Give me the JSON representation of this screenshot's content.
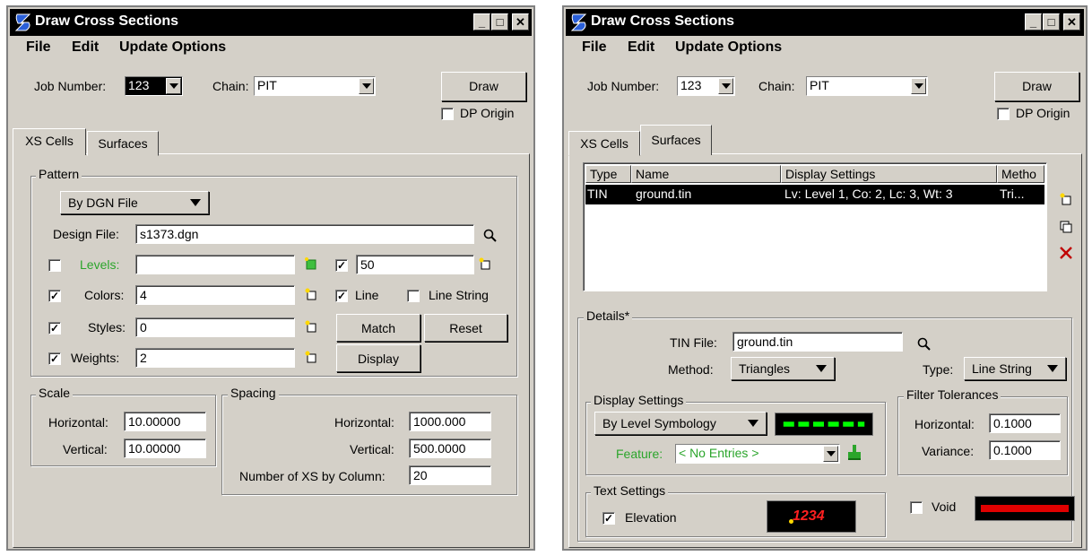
{
  "left_window": {
    "title": "Draw Cross Sections",
    "menu": [
      "File",
      "Edit",
      "Update Options"
    ],
    "job_number_label": "Job Number:",
    "job_number_value": "123",
    "chain_label": "Chain:",
    "chain_value": "PIT",
    "draw_label": "Draw",
    "dp_origin_label": "DP Origin",
    "tabs": [
      "XS Cells",
      "Surfaces"
    ],
    "pattern": {
      "group_label": "Pattern",
      "mode": "By DGN File",
      "design_file_label": "Design File:",
      "design_file_value": "s1373.dgn",
      "levels_label": "Levels:",
      "levels_value": "",
      "levels_count": "50",
      "colors_label": "Colors:",
      "colors_value": "4",
      "line_label": "Line",
      "line_string_label": "Line String",
      "styles_label": "Styles:",
      "styles_value": "0",
      "match_label": "Match",
      "reset_label": "Reset",
      "weights_label": "Weights:",
      "weights_value": "2",
      "display_label": "Display"
    },
    "scale": {
      "group_label": "Scale",
      "horizontal_label": "Horizontal:",
      "horizontal_value": "10.00000",
      "vertical_label": "Vertical:",
      "vertical_value": "10.00000"
    },
    "spacing": {
      "group_label": "Spacing",
      "horizontal_label": "Horizontal:",
      "horizontal_value": "1000.000",
      "vertical_label": "Vertical:",
      "vertical_value": "500.0000",
      "columns_label": "Number of XS by Column:",
      "columns_value": "20"
    }
  },
  "right_window": {
    "title": "Draw Cross Sections",
    "menu": [
      "File",
      "Edit",
      "Update Options"
    ],
    "job_number_label": "Job Number:",
    "job_number_value": "123",
    "chain_label": "Chain:",
    "chain_value": "PIT",
    "draw_label": "Draw",
    "dp_origin_label": "DP Origin",
    "tabs": [
      "XS Cells",
      "Surfaces"
    ],
    "surface_list": {
      "columns": [
        "Type",
        "Name",
        "Display Settings",
        "Metho"
      ],
      "rows": [
        {
          "type": "TIN",
          "name": "ground.tin",
          "display": "Lv: Level 1, Co: 2, Lc: 3, Wt: 3",
          "method": "Tri..."
        }
      ]
    },
    "details": {
      "group_label": "Details*",
      "tin_file_label": "TIN File:",
      "tin_file_value": "ground.tin",
      "method_label": "Method:",
      "method_value": "Triangles",
      "type_label": "Type:",
      "type_value": "Line String"
    },
    "display_settings": {
      "group_label": "Display Settings",
      "mode": "By Level Symbology",
      "feature_label": "Feature:",
      "feature_value": "< No Entries >",
      "line_color": "#00ff00"
    },
    "filter_tolerances": {
      "group_label": "Filter Tolerances",
      "horizontal_label": "Horizontal:",
      "horizontal_value": "0.1000",
      "variance_label": "Variance:",
      "variance_value": "0.1000"
    },
    "text_settings": {
      "group_label": "Text Settings",
      "elevation_label": "Elevation",
      "preview_text": "1234",
      "preview_color": "#ff2020"
    },
    "void_label": "Void",
    "void_color": "#e00000"
  }
}
